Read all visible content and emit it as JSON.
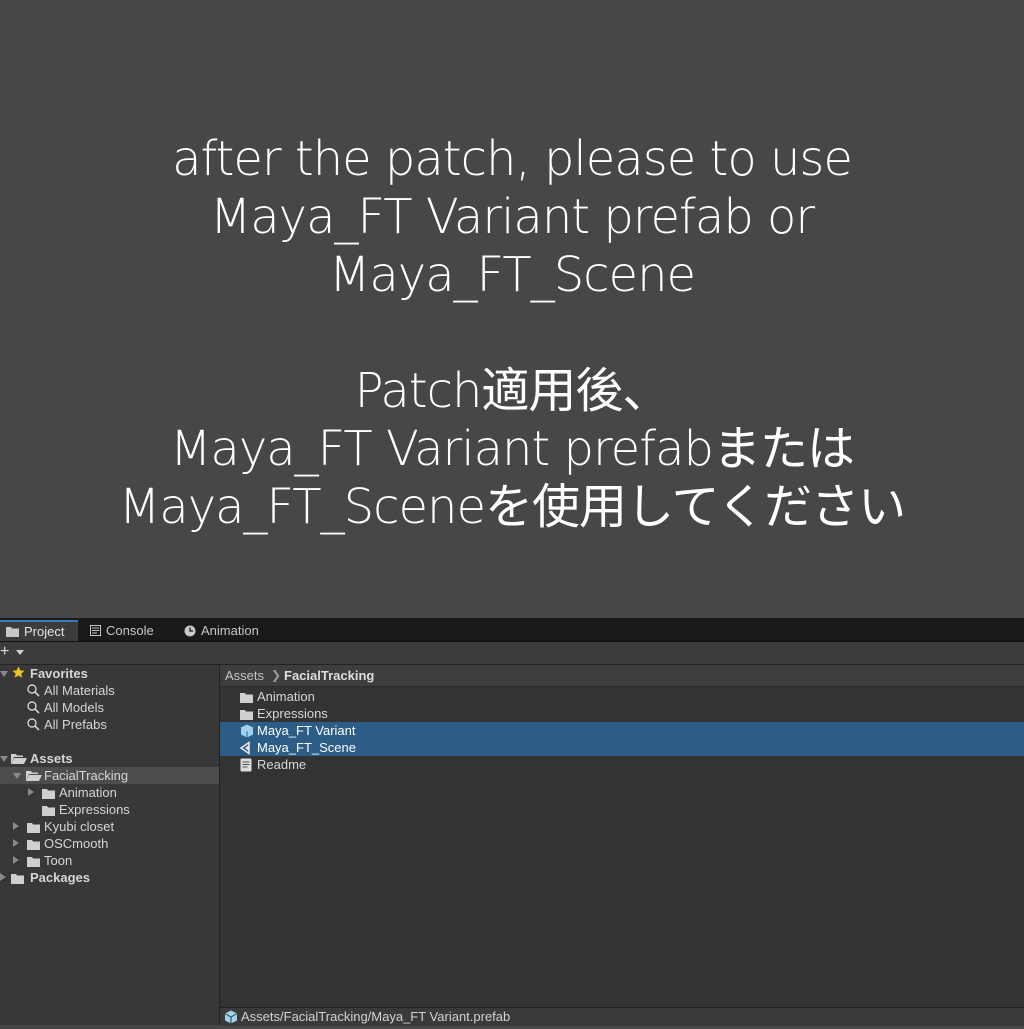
{
  "message": {
    "en_lines": [
      "after the patch, please to use",
      "Maya_FT Variant prefab or",
      "Maya_FT_Scene"
    ],
    "ja_lines": [
      "Patch適用後、",
      "Maya_FT Variant prefabまたは",
      "Maya_FT_Sceneを使用してください"
    ]
  },
  "tabs": [
    {
      "label": "Project",
      "icon": "folder-icon",
      "active": true
    },
    {
      "label": "Console",
      "icon": "console-icon",
      "active": false
    },
    {
      "label": "Animation",
      "icon": "animation-clock-icon",
      "active": false
    }
  ],
  "toolbar": {
    "add_label": "+"
  },
  "tree": {
    "favorites": {
      "label": "Favorites",
      "items": [
        "All Materials",
        "All Models",
        "All Prefabs"
      ]
    },
    "assets": {
      "label": "Assets",
      "facial_tracking": {
        "label": "FacialTracking",
        "children": [
          "Animation",
          "Expressions"
        ]
      },
      "others": [
        "Kyubi closet",
        "OSCmooth",
        "Toon"
      ]
    },
    "packages": {
      "label": "Packages"
    }
  },
  "breadcrumb": {
    "root": "Assets",
    "current": "FacialTracking"
  },
  "files": [
    {
      "label": "Animation",
      "icon": "folder-icon",
      "selected": false
    },
    {
      "label": "Expressions",
      "icon": "folder-icon",
      "selected": false
    },
    {
      "label": "Maya_FT Variant",
      "icon": "prefab-variant-icon",
      "selected": true
    },
    {
      "label": "Maya_FT_Scene",
      "icon": "unity-scene-icon",
      "selected": true
    },
    {
      "label": "Readme",
      "icon": "text-asset-icon",
      "selected": false
    }
  ],
  "status": {
    "path": "Assets/FacialTracking/Maya_FT Variant.prefab"
  },
  "colors": {
    "background": "#474747",
    "selection": "#2c5d87",
    "tab_accent": "#3a79bb"
  }
}
